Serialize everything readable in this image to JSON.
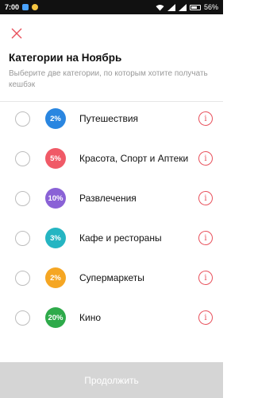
{
  "status_bar": {
    "time": "7:00",
    "battery": "56%",
    "icons": [
      "app-icon",
      "moon-icon",
      "wifi-icon",
      "signal-icon",
      "battery-icon"
    ]
  },
  "header": {
    "close_icon": "close-icon",
    "title": "Категории на Ноябрь",
    "subtitle": "Выберите две категории, по которым хотите получать кешбэк"
  },
  "categories": [
    {
      "percent": "2%",
      "label": "Путешествия",
      "color": "#2a86e0"
    },
    {
      "percent": "5%",
      "label": "Красота, Спорт и Аптеки",
      "color": "#f05a67"
    },
    {
      "percent": "10%",
      "label": "Развлечения",
      "color": "#8a62d6"
    },
    {
      "percent": "3%",
      "label": "Кафе и рестораны",
      "color": "#25b5c2"
    },
    {
      "percent": "2%",
      "label": "Супермаркеты",
      "color": "#f5a623"
    },
    {
      "percent": "20%",
      "label": "Кино",
      "color": "#2eaa4a"
    }
  ],
  "info_icon_symbol": "i",
  "accent_color": "#e8505b",
  "footer": {
    "button_label": "Продолжить"
  }
}
